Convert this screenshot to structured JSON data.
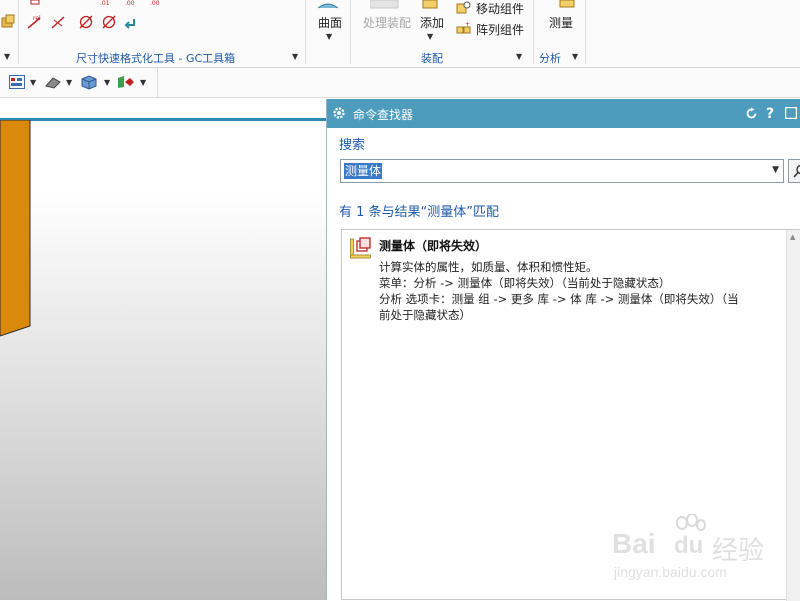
{
  "ribbon": {
    "group_gc_toolbox": "尺寸快速格式化工具 - GC工具箱",
    "surface_label": "曲面",
    "process_assembly_label": "处理装配",
    "add_label": "添加",
    "move_component_label": "移动组件",
    "array_component_label": "阵列组件",
    "group_assembly": "装配",
    "measure_label": "测量",
    "group_analysis": "分析"
  },
  "command_finder": {
    "title": "命令查找器",
    "search_label": "搜索",
    "search_value": "测量体",
    "result_summary": "有 1 条与结果“测量体”匹配",
    "result": {
      "title": "测量体（即将失效）",
      "lines": [
        "计算实体的属性，如质量、体积和惯性矩。",
        "菜单：分析    -> 测量体（即将失效）（当前处于隐藏状态）",
        "分析 选项卡：测量 组 -> 更多 库 -> 体 库 -> 测量体（即将失效）（当",
        "前处于隐藏状态）"
      ]
    }
  },
  "watermark": {
    "brand": "Bai",
    "brand2": "du",
    "cn": "经验",
    "url": "jingyan.baidu.com"
  },
  "colors": {
    "panel_header": "#4d9cbd",
    "link_blue": "#1e5aa8",
    "selection": "#3a78c8",
    "solid_orange": "#d98a0a"
  }
}
